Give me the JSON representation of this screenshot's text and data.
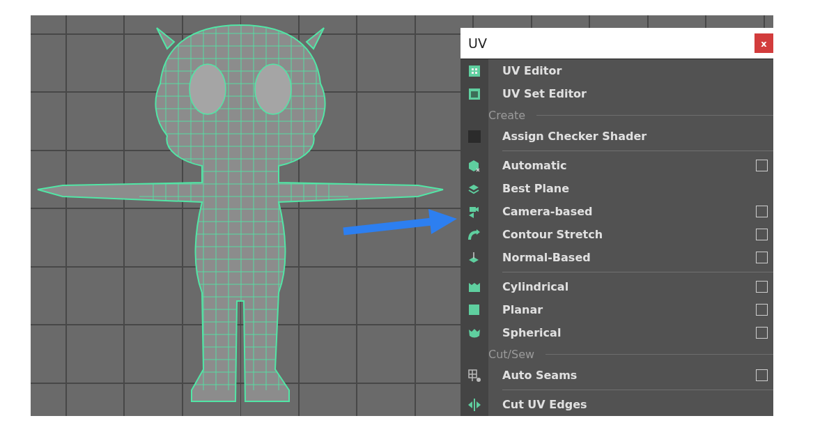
{
  "menu": {
    "title": "UV",
    "close_label": "x",
    "items": [
      {
        "kind": "item",
        "label": "UV Editor",
        "option_box": false
      },
      {
        "kind": "item",
        "label": "UV Set Editor",
        "option_box": false
      },
      {
        "kind": "header",
        "label": "Create"
      },
      {
        "kind": "item",
        "label": "Assign Checker Shader",
        "option_box": false
      },
      {
        "kind": "separator"
      },
      {
        "kind": "item",
        "label": "Automatic",
        "option_box": true
      },
      {
        "kind": "item",
        "label": "Best Plane",
        "option_box": false
      },
      {
        "kind": "item",
        "label": "Camera-based",
        "option_box": true
      },
      {
        "kind": "item",
        "label": "Contour Stretch",
        "option_box": true
      },
      {
        "kind": "item",
        "label": "Normal-Based",
        "option_box": true
      },
      {
        "kind": "separator"
      },
      {
        "kind": "item",
        "label": "Cylindrical",
        "option_box": true
      },
      {
        "kind": "item",
        "label": "Planar",
        "option_box": true
      },
      {
        "kind": "item",
        "label": "Spherical",
        "option_box": true
      },
      {
        "kind": "header",
        "label": "Cut/Sew"
      },
      {
        "kind": "item",
        "label": "Auto Seams",
        "option_box": true
      },
      {
        "kind": "separator"
      },
      {
        "kind": "item",
        "label": "Cut UV Edges",
        "option_box": false
      }
    ]
  }
}
